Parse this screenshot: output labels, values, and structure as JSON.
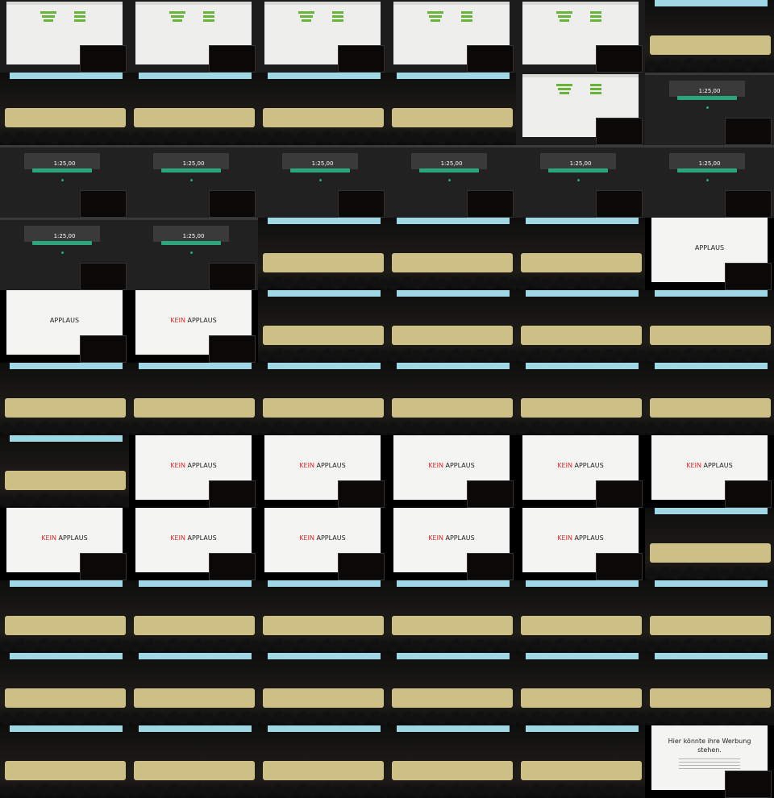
{
  "tiles": [
    "desktop",
    "desktop",
    "desktop",
    "desktop",
    "desktop",
    "stage",
    "stage",
    "stage",
    "stage",
    "stage",
    "desktop",
    "timer",
    "timer",
    "timer",
    "timer",
    "timer",
    "timer",
    "timer",
    "timer",
    "timer",
    "stage",
    "stage",
    "stage",
    "applaus",
    "applaus",
    "kein",
    "stage",
    "stage",
    "stage",
    "stage",
    "stage",
    "stage",
    "stage",
    "stage",
    "stage",
    "stage",
    "stage",
    "kein",
    "kein",
    "kein",
    "kein",
    "kein",
    "kein",
    "kein",
    "kein",
    "kein",
    "kein",
    "stage",
    "stage",
    "stage",
    "stage",
    "stage",
    "stage",
    "stage",
    "stage",
    "stage",
    "stage",
    "stage",
    "stage",
    "stage",
    "stage",
    "stage",
    "stage",
    "stage",
    "stage",
    "werbung"
  ],
  "slides": {
    "timer": {
      "value": "1:25,00"
    },
    "applaus": {
      "text": "APPLAUS"
    },
    "kein": {
      "red": "KEIN",
      "rest": " APPLAUS"
    },
    "werbung": {
      "title": "Hier könnte ihre Werbung stehen."
    }
  },
  "colors": {
    "accent": "#2aa57c",
    "red": "#d12b2b",
    "stage_bg": "#151412",
    "slide_bg": "#f4f4f2"
  }
}
